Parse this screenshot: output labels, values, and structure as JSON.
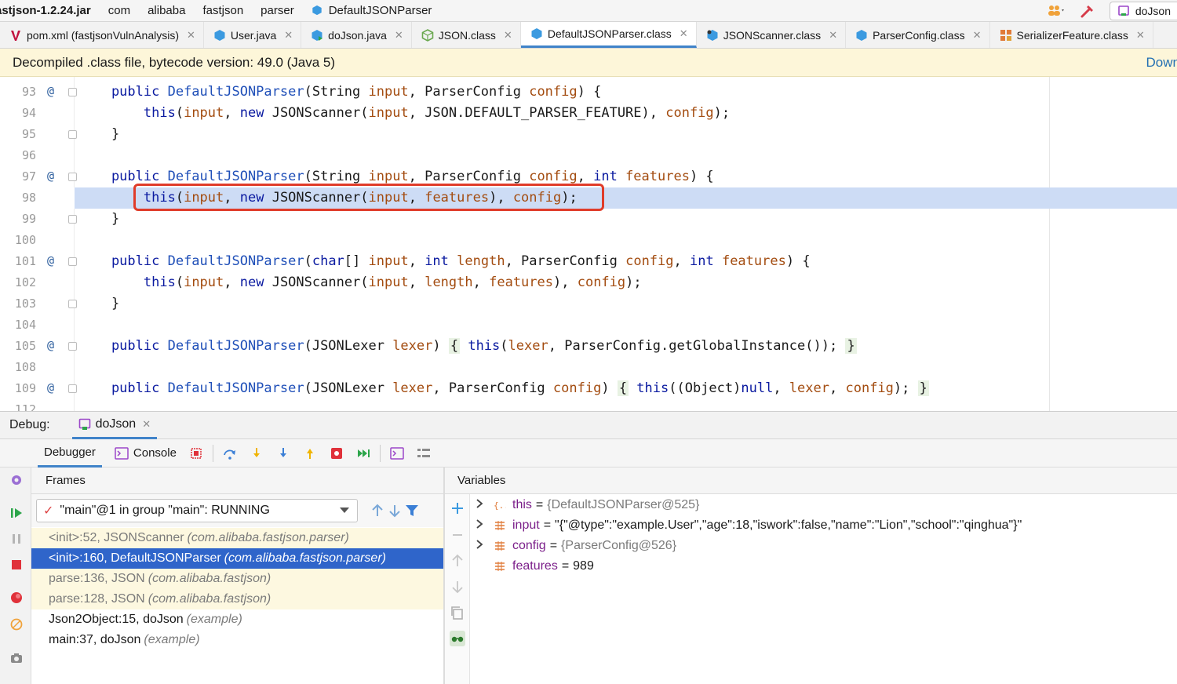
{
  "nav": {
    "crumbs": [
      "astjson-1.2.24.jar",
      "com",
      "alibaba",
      "fastjson",
      "parser",
      "DefaultJSONParser"
    ],
    "run_config": "doJson"
  },
  "tabs": [
    {
      "label": "pom.xml (fastjsonVulnAnalysis)",
      "icon": "maven-icon",
      "active": false
    },
    {
      "label": "User.java",
      "icon": "java-class-icon",
      "active": false
    },
    {
      "label": "doJson.java",
      "icon": "java-run-class-icon",
      "active": false
    },
    {
      "label": "JSON.class",
      "icon": "class-file-icon",
      "active": false
    },
    {
      "label": "DefaultJSONParser.class",
      "icon": "class-file-icon",
      "active": true
    },
    {
      "label": "JSONScanner.class",
      "icon": "class-file-icon",
      "active": false
    },
    {
      "label": "ParserConfig.class",
      "icon": "class-file-icon",
      "active": false
    },
    {
      "label": "SerializerFeature.class",
      "icon": "enum-icon",
      "active": false
    }
  ],
  "banner": {
    "text": "Decompiled .class file, bytecode version: 49.0 (Java 5)",
    "link": "Down"
  },
  "code_lines": [
    {
      "ln": "93",
      "at": true,
      "fold": true,
      "hl": false,
      "tokens": [
        [
          "kw",
          "    public "
        ],
        [
          "fn",
          "DefaultJSONParser"
        ],
        [
          "plain",
          "(String "
        ],
        [
          "par",
          "input"
        ],
        [
          "plain",
          ", ParserConfig "
        ],
        [
          "par",
          "config"
        ],
        [
          "plain",
          ") {"
        ]
      ]
    },
    {
      "ln": "94",
      "at": false,
      "fold": false,
      "hl": false,
      "tokens": [
        [
          "kw",
          "        this"
        ],
        [
          "plain",
          "("
        ],
        [
          "par",
          "input"
        ],
        [
          "plain",
          ", "
        ],
        [
          "kw",
          "new "
        ],
        [
          "plain",
          "JSONScanner("
        ],
        [
          "par",
          "input"
        ],
        [
          "plain",
          ", JSON.DEFAULT_PARSER_FEATURE), "
        ],
        [
          "par",
          "config"
        ],
        [
          "plain",
          ");"
        ]
      ]
    },
    {
      "ln": "95",
      "at": false,
      "fold": true,
      "hl": false,
      "tokens": [
        [
          "plain",
          "    }"
        ]
      ]
    },
    {
      "ln": "96",
      "at": false,
      "fold": false,
      "hl": false,
      "tokens": []
    },
    {
      "ln": "97",
      "at": true,
      "fold": true,
      "hl": false,
      "tokens": [
        [
          "kw",
          "    public "
        ],
        [
          "fn",
          "DefaultJSONParser"
        ],
        [
          "plain",
          "(String "
        ],
        [
          "par",
          "input"
        ],
        [
          "plain",
          ", ParserConfig "
        ],
        [
          "par",
          "config"
        ],
        [
          "plain",
          ", "
        ],
        [
          "kw",
          "int "
        ],
        [
          "par",
          "features"
        ],
        [
          "plain",
          ") {"
        ]
      ]
    },
    {
      "ln": "98",
      "at": false,
      "fold": false,
      "hl": true,
      "tokens": [
        [
          "kw",
          "        this"
        ],
        [
          "plain",
          "("
        ],
        [
          "par",
          "input"
        ],
        [
          "plain",
          ", "
        ],
        [
          "kw",
          "new "
        ],
        [
          "plain",
          "JSONScanner("
        ],
        [
          "par",
          "input"
        ],
        [
          "plain",
          ", "
        ],
        [
          "par",
          "features"
        ],
        [
          "plain",
          "), "
        ],
        [
          "par",
          "config"
        ],
        [
          "plain",
          ");"
        ]
      ]
    },
    {
      "ln": "99",
      "at": false,
      "fold": true,
      "hl": false,
      "tokens": [
        [
          "plain",
          "    }"
        ]
      ]
    },
    {
      "ln": "100",
      "at": false,
      "fold": false,
      "hl": false,
      "tokens": []
    },
    {
      "ln": "101",
      "at": true,
      "fold": true,
      "hl": false,
      "tokens": [
        [
          "kw",
          "    public "
        ],
        [
          "fn",
          "DefaultJSONParser"
        ],
        [
          "plain",
          "("
        ],
        [
          "kw",
          "char"
        ],
        [
          "plain",
          "[] "
        ],
        [
          "par",
          "input"
        ],
        [
          "plain",
          ", "
        ],
        [
          "kw",
          "int "
        ],
        [
          "par",
          "length"
        ],
        [
          "plain",
          ", ParserConfig "
        ],
        [
          "par",
          "config"
        ],
        [
          "plain",
          ", "
        ],
        [
          "kw",
          "int "
        ],
        [
          "par",
          "features"
        ],
        [
          "plain",
          ") {"
        ]
      ]
    },
    {
      "ln": "102",
      "at": false,
      "fold": false,
      "hl": false,
      "tokens": [
        [
          "kw",
          "        this"
        ],
        [
          "plain",
          "("
        ],
        [
          "par",
          "input"
        ],
        [
          "plain",
          ", "
        ],
        [
          "kw",
          "new "
        ],
        [
          "plain",
          "JSONScanner("
        ],
        [
          "par",
          "input"
        ],
        [
          "plain",
          ", "
        ],
        [
          "par",
          "length"
        ],
        [
          "plain",
          ", "
        ],
        [
          "par",
          "features"
        ],
        [
          "plain",
          "), "
        ],
        [
          "par",
          "config"
        ],
        [
          "plain",
          ");"
        ]
      ]
    },
    {
      "ln": "103",
      "at": false,
      "fold": true,
      "hl": false,
      "tokens": [
        [
          "plain",
          "    }"
        ]
      ]
    },
    {
      "ln": "104",
      "at": false,
      "fold": false,
      "hl": false,
      "tokens": []
    },
    {
      "ln": "105",
      "at": true,
      "fold": true,
      "hl": false,
      "tokens": [
        [
          "kw",
          "    public "
        ],
        [
          "fn",
          "DefaultJSONParser"
        ],
        [
          "plain",
          "(JSONLexer "
        ],
        [
          "par",
          "lexer"
        ],
        [
          "plain",
          ") "
        ],
        [
          "grp",
          "{"
        ],
        [
          "kw",
          " this"
        ],
        [
          "plain",
          "("
        ],
        [
          "par",
          "lexer"
        ],
        [
          "plain",
          ", ParserConfig.getGlobalInstance()); "
        ],
        [
          "grp",
          "}"
        ]
      ]
    },
    {
      "ln": "108",
      "at": false,
      "fold": false,
      "hl": false,
      "tokens": []
    },
    {
      "ln": "109",
      "at": true,
      "fold": true,
      "hl": false,
      "tokens": [
        [
          "kw",
          "    public "
        ],
        [
          "fn",
          "DefaultJSONParser"
        ],
        [
          "plain",
          "(JSONLexer "
        ],
        [
          "par",
          "lexer"
        ],
        [
          "plain",
          ", ParserConfig "
        ],
        [
          "par",
          "config"
        ],
        [
          "plain",
          ") "
        ],
        [
          "grp",
          "{"
        ],
        [
          "kw",
          " this"
        ],
        [
          "plain",
          "((Object)"
        ],
        [
          "kw",
          "null"
        ],
        [
          "plain",
          ", "
        ],
        [
          "par",
          "lexer"
        ],
        [
          "plain",
          ", "
        ],
        [
          "par",
          "config"
        ],
        [
          "plain",
          "); "
        ],
        [
          "grp",
          "}"
        ]
      ]
    },
    {
      "ln": "112",
      "at": false,
      "fold": false,
      "hl": false,
      "tokens": []
    }
  ],
  "debug": {
    "label": "Debug:",
    "session": "doJson",
    "tabs": {
      "debugger": "Debugger",
      "console": "Console"
    },
    "frames_header": "Frames",
    "variables_header": "Variables",
    "thread": "\"main\"@1 in group \"main\": RUNNING",
    "frames": [
      {
        "loc": "<init>:52, JSONScanner",
        "pkg": "(com.alibaba.fastjson.parser)",
        "kind": "lib"
      },
      {
        "loc": "<init>:160, DefaultJSONParser",
        "pkg": "(com.alibaba.fastjson.parser)",
        "kind": "sel"
      },
      {
        "loc": "parse:136, JSON",
        "pkg": "(com.alibaba.fastjson)",
        "kind": "lib"
      },
      {
        "loc": "parse:128, JSON",
        "pkg": "(com.alibaba.fastjson)",
        "kind": "lib"
      },
      {
        "loc": "Json2Object:15, doJson",
        "pkg": "(example)",
        "kind": "user"
      },
      {
        "loc": "main:37, doJson",
        "pkg": "(example)",
        "kind": "user"
      }
    ],
    "variables": [
      {
        "expandable": true,
        "icon": "object-icon",
        "name": "this",
        "value": "{DefaultJSONParser@525}",
        "ref": true
      },
      {
        "expandable": true,
        "icon": "field-icon",
        "name": "input",
        "value": "\"{\"@type\":\"example.User\",\"age\":18,\"iswork\":false,\"name\":\"Lion\",\"school\":\"qinghua\"}\"",
        "ref": false
      },
      {
        "expandable": true,
        "icon": "field-icon",
        "name": "config",
        "value": "{ParserConfig@526}",
        "ref": true
      },
      {
        "expandable": false,
        "icon": "field-icon",
        "name": "features",
        "value": "989",
        "ref": false
      }
    ]
  }
}
